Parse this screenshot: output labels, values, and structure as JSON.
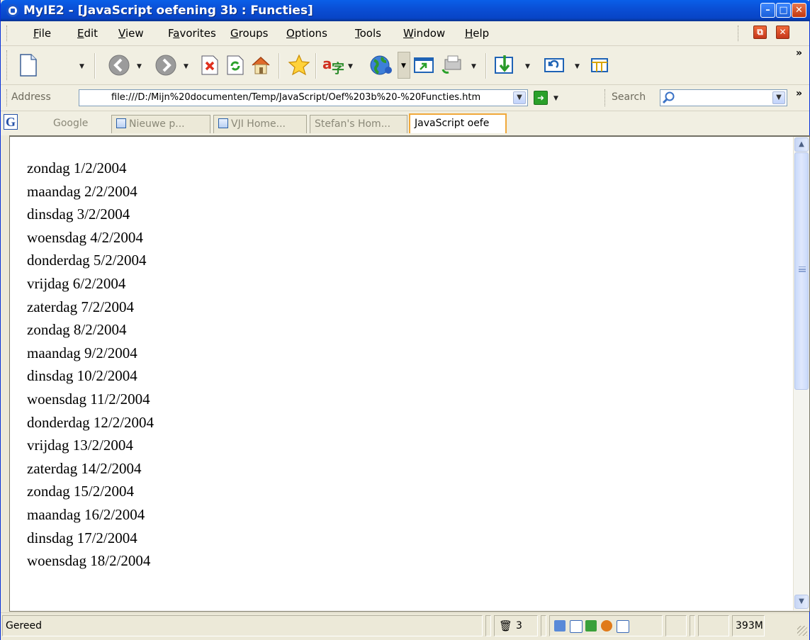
{
  "window": {
    "title": "MyIE2 - [JavaScript oefening 3b : Functies]",
    "controls": [
      "minimize",
      "maximize",
      "close"
    ]
  },
  "menubar": {
    "items": [
      {
        "pre": "",
        "u": "F",
        "post": "ile"
      },
      {
        "pre": "",
        "u": "E",
        "post": "dit"
      },
      {
        "pre": "",
        "u": "V",
        "post": "iew"
      },
      {
        "pre": "F",
        "u": "a",
        "post": "vorites"
      },
      {
        "pre": "",
        "u": "G",
        "post": "roups"
      },
      {
        "pre": "",
        "u": "O",
        "post": "ptions"
      },
      {
        "pre": "",
        "u": "T",
        "post": "ools"
      },
      {
        "pre": "",
        "u": "W",
        "post": "indow"
      },
      {
        "pre": "",
        "u": "H",
        "post": "elp"
      }
    ]
  },
  "toolbar": {
    "icons": [
      "new-page-icon",
      "back-icon",
      "forward-icon",
      "stop-icon",
      "refresh-icon",
      "home-icon",
      "favorites-star-icon",
      "encoding-icon",
      "web-globe-icon",
      "new-window-icon",
      "print-icon",
      "download-icon",
      "undo-close-icon",
      "view-icon"
    ],
    "chevron": "»"
  },
  "address": {
    "label": "Address",
    "value": "file:///D:/Mijn%20documenten/Temp/JavaScript/Oef%203b%20-%20Functies.htm",
    "search_label": "Search",
    "search_value": ""
  },
  "tabs": [
    {
      "label": "Google",
      "icon": "google-icon"
    },
    {
      "label": "Nieuwe p...",
      "icon": "ie-page-icon"
    },
    {
      "label": "VJI Home...",
      "icon": "ie-page-icon"
    },
    {
      "label": "Stefan's Hom...",
      "icon": ""
    },
    {
      "label": "JavaScript oefe",
      "icon": "",
      "active": true
    }
  ],
  "document": {
    "lines": [
      "zondag 1/2/2004",
      "maandag 2/2/2004",
      "dinsdag 3/2/2004",
      "woensdag 4/2/2004",
      "donderdag 5/2/2004",
      "vrijdag 6/2/2004",
      "zaterdag 7/2/2004",
      "zondag 8/2/2004",
      "maandag 9/2/2004",
      "dinsdag 10/2/2004",
      "woensdag 11/2/2004",
      "donderdag 12/2/2004",
      "vrijdag 13/2/2004",
      "zaterdag 14/2/2004",
      "zondag 15/2/2004",
      "maandag 16/2/2004",
      "dinsdag 17/2/2004",
      "woensdag 18/2/2004"
    ]
  },
  "status": {
    "text": "Gereed",
    "trash_count": "3",
    "memory": "393M"
  }
}
